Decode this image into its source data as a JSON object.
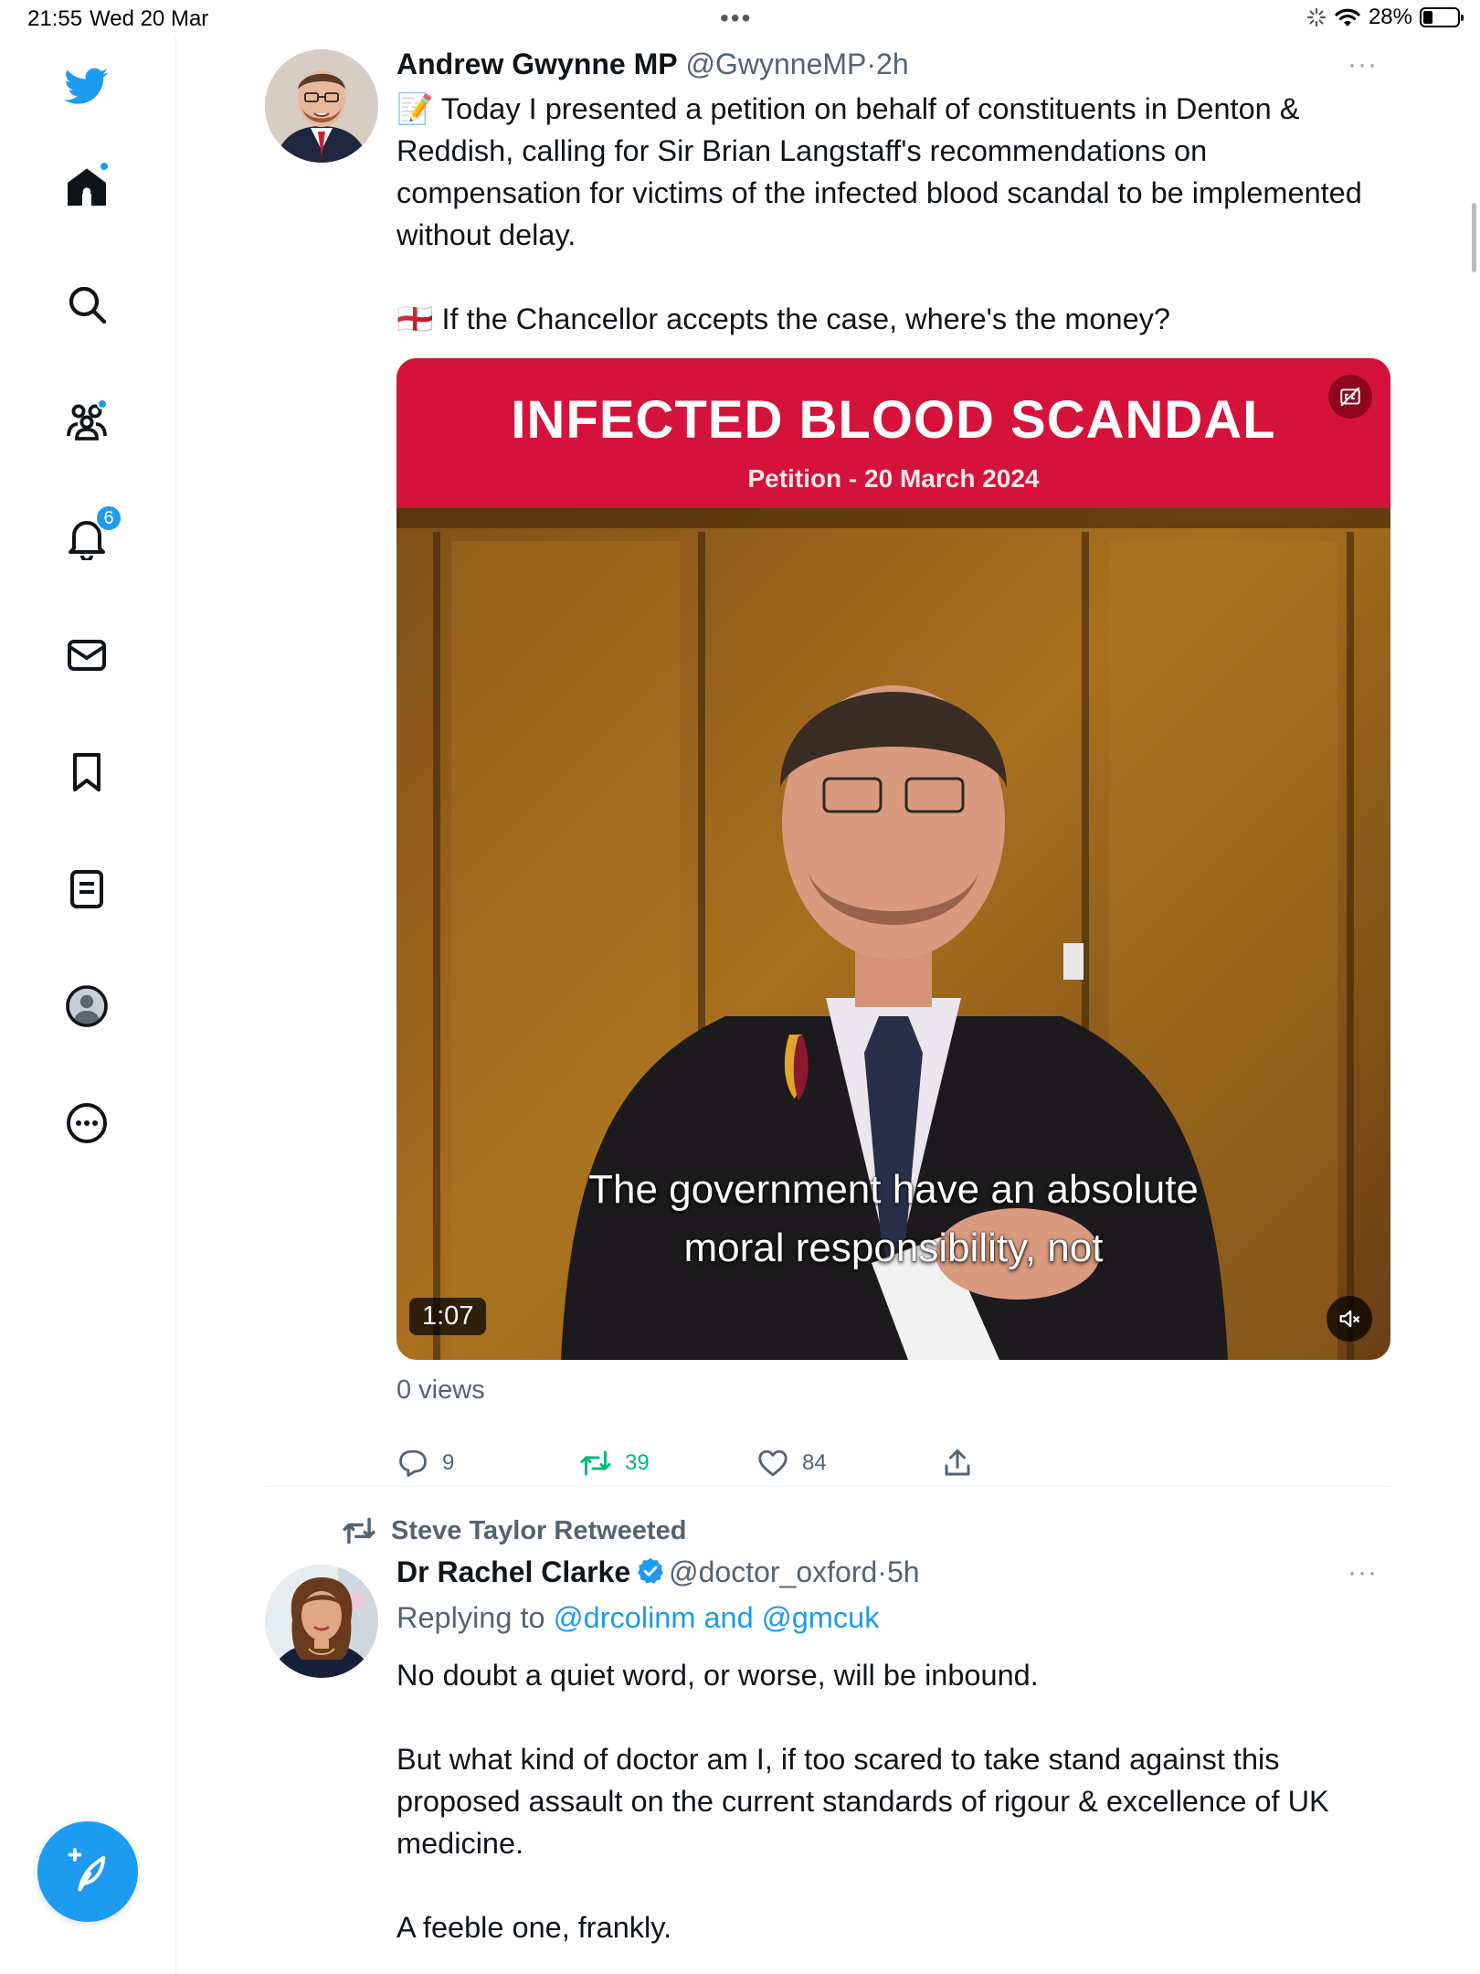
{
  "status_bar": {
    "time": "21:55",
    "date": "Wed 20 Mar",
    "battery": "28%",
    "battery_level": 0.28
  },
  "sidebar": {
    "items": [
      {
        "icon": "twitter-bird-icon"
      },
      {
        "icon": "home-icon",
        "has_dot": true
      },
      {
        "icon": "search-icon"
      },
      {
        "icon": "communities-icon",
        "has_dot": true
      },
      {
        "icon": "notifications-icon",
        "badge": "6"
      },
      {
        "icon": "messages-icon"
      },
      {
        "icon": "bookmarks-icon"
      },
      {
        "icon": "lists-icon"
      },
      {
        "icon": "profile-icon"
      },
      {
        "icon": "more-icon"
      }
    ],
    "compose_icon": "compose-feather-icon",
    "accent_color": "#1d9bf0"
  },
  "tweets": [
    {
      "name": "Andrew Gwynne MP",
      "handle": "@GwynneMP",
      "separator": "·",
      "age": "2h",
      "more": "···",
      "text_p1": "📝 Today I presented a petition on behalf of constituents in Denton & Reddish, calling for Sir Brian Langstaff's recommendations on compensation for victims of the infected blood scandal to be implemented without delay.",
      "text_p2": "🏴󠁧󠁢󠁥󠁮󠁧󠁿 If the Chancellor accepts the case, where's the money?",
      "media": {
        "title": "INFECTED BLOOD SCANDAL",
        "subtitle": "Petition - 20 March 2024",
        "caption_line1": "The government have an absolute",
        "caption_line2": "moral responsibility, not",
        "duration": "1:07",
        "banner_color": "#d5133a"
      },
      "views": "0 views",
      "replies": "9",
      "retweets": "39",
      "likes": "84"
    },
    {
      "retweeted_by": "Steve Taylor Retweeted",
      "name": "Dr Rachel Clarke",
      "handle": "@doctor_oxford",
      "separator": "·",
      "age": "5h",
      "more": "···",
      "replying_prefix": "Replying to",
      "replying_handles": "@drcolinm and @gmcuk",
      "text_p1": "No doubt a quiet word, or worse, will be inbound.",
      "text_p2": "But what kind of doctor am I, if too scared to take stand against this proposed assault on the current standards of rigour & excellence of UK medicine.",
      "text_p3": "A feeble one, frankly."
    }
  ]
}
